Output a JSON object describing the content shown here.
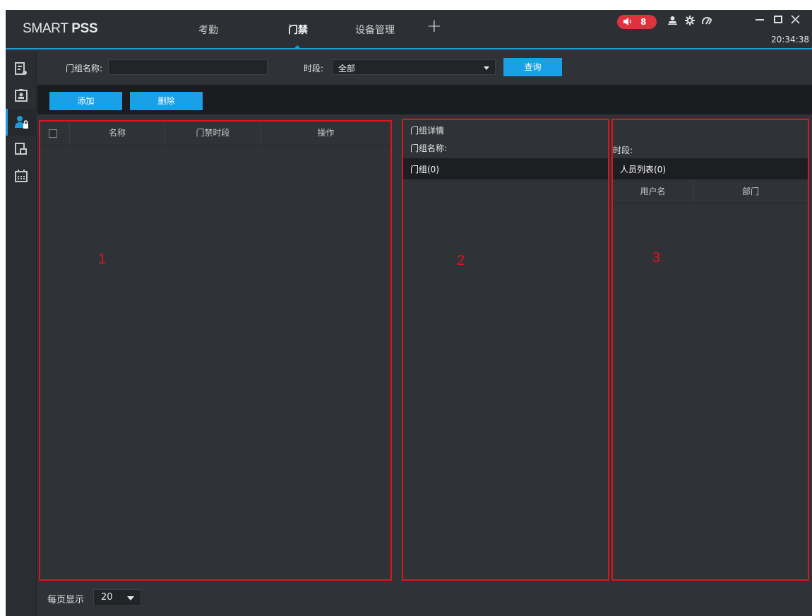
{
  "app": {
    "logo_light": "SMART ",
    "logo_bold": "PSS",
    "tabs": [
      {
        "label": "考勤"
      },
      {
        "label": "门禁"
      },
      {
        "label": "设备管理"
      }
    ],
    "add_tab": "+",
    "alarm_count": "8",
    "clock": "20:34:38",
    "accent_color": "#1f9bd8",
    "alarm_color": "#e0323c"
  },
  "icons": {
    "speaker": "speaker-icon",
    "user": "user-icon",
    "settings": "gear-icon",
    "performance": "gauge-icon",
    "minimize": "minimize-icon",
    "maximize": "maximize-icon",
    "close": "close-icon"
  },
  "sidebar": {
    "items": [
      {
        "name": "attendance-report-icon"
      },
      {
        "name": "person-card-icon"
      },
      {
        "name": "access-person-icon"
      },
      {
        "name": "door-record-icon"
      },
      {
        "name": "calendar-icon"
      }
    ]
  },
  "filter": {
    "name_label": "门组名称:",
    "name_value": "",
    "period_label": "时段:",
    "period_value": "全部",
    "query_button": "查询"
  },
  "actions": {
    "add": "添加",
    "delete": "删除"
  },
  "group_table": {
    "columns": [
      "名称",
      "门禁时段",
      "操作"
    ],
    "rows": []
  },
  "detail": {
    "title": "门组详情",
    "name_label": "门组名称:",
    "group_header": "门组(0)"
  },
  "members": {
    "period_label": "时段:",
    "list_header": "人员列表(0)",
    "columns": [
      "用户名",
      "部门"
    ]
  },
  "annotations": [
    "1",
    "2",
    "3"
  ],
  "pager": {
    "label": "每页显示",
    "page_size": "20"
  }
}
